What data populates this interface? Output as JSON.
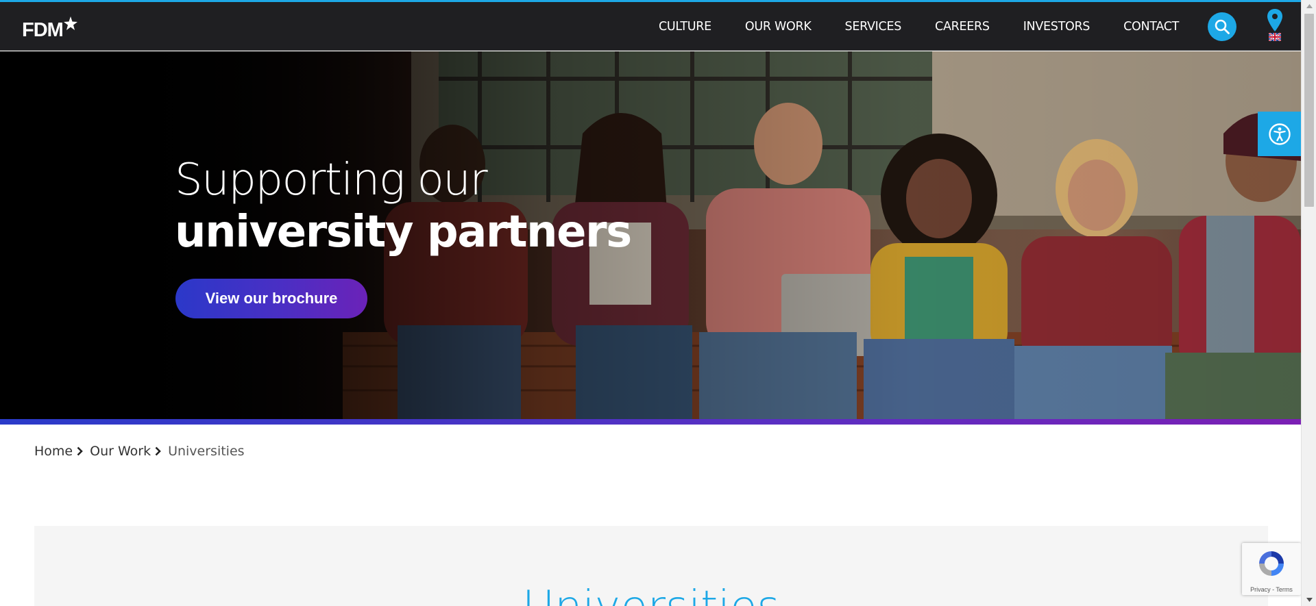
{
  "header": {
    "logo_text": "FDM",
    "nav": [
      "CULTURE",
      "OUR WORK",
      "SERVICES",
      "CAREERS",
      "INVESTORS",
      "CONTACT"
    ]
  },
  "hero": {
    "title_line1": "Supporting our",
    "title_line2": "university partners",
    "cta_label": "View our brochure"
  },
  "breadcrumb": {
    "items": [
      "Home",
      "Our Work"
    ],
    "current": "Universities"
  },
  "main": {
    "section_title": "Universities"
  },
  "recaptcha": {
    "footer": "Privacy - Terms"
  },
  "icons": {
    "search": "search-icon",
    "locale": "map-pin-icon",
    "flag": "uk-flag-icon",
    "accessibility": "accessibility-icon",
    "breadcrumb_separator": "chevron-right-icon",
    "recaptcha": "recaptcha-icon"
  },
  "colors": {
    "accent": "#1da8e6",
    "header_bg": "#1f1f22",
    "cta_start": "#2b38c9",
    "cta_end": "#6b22b8",
    "content_box_bg": "#f5f5f5"
  }
}
